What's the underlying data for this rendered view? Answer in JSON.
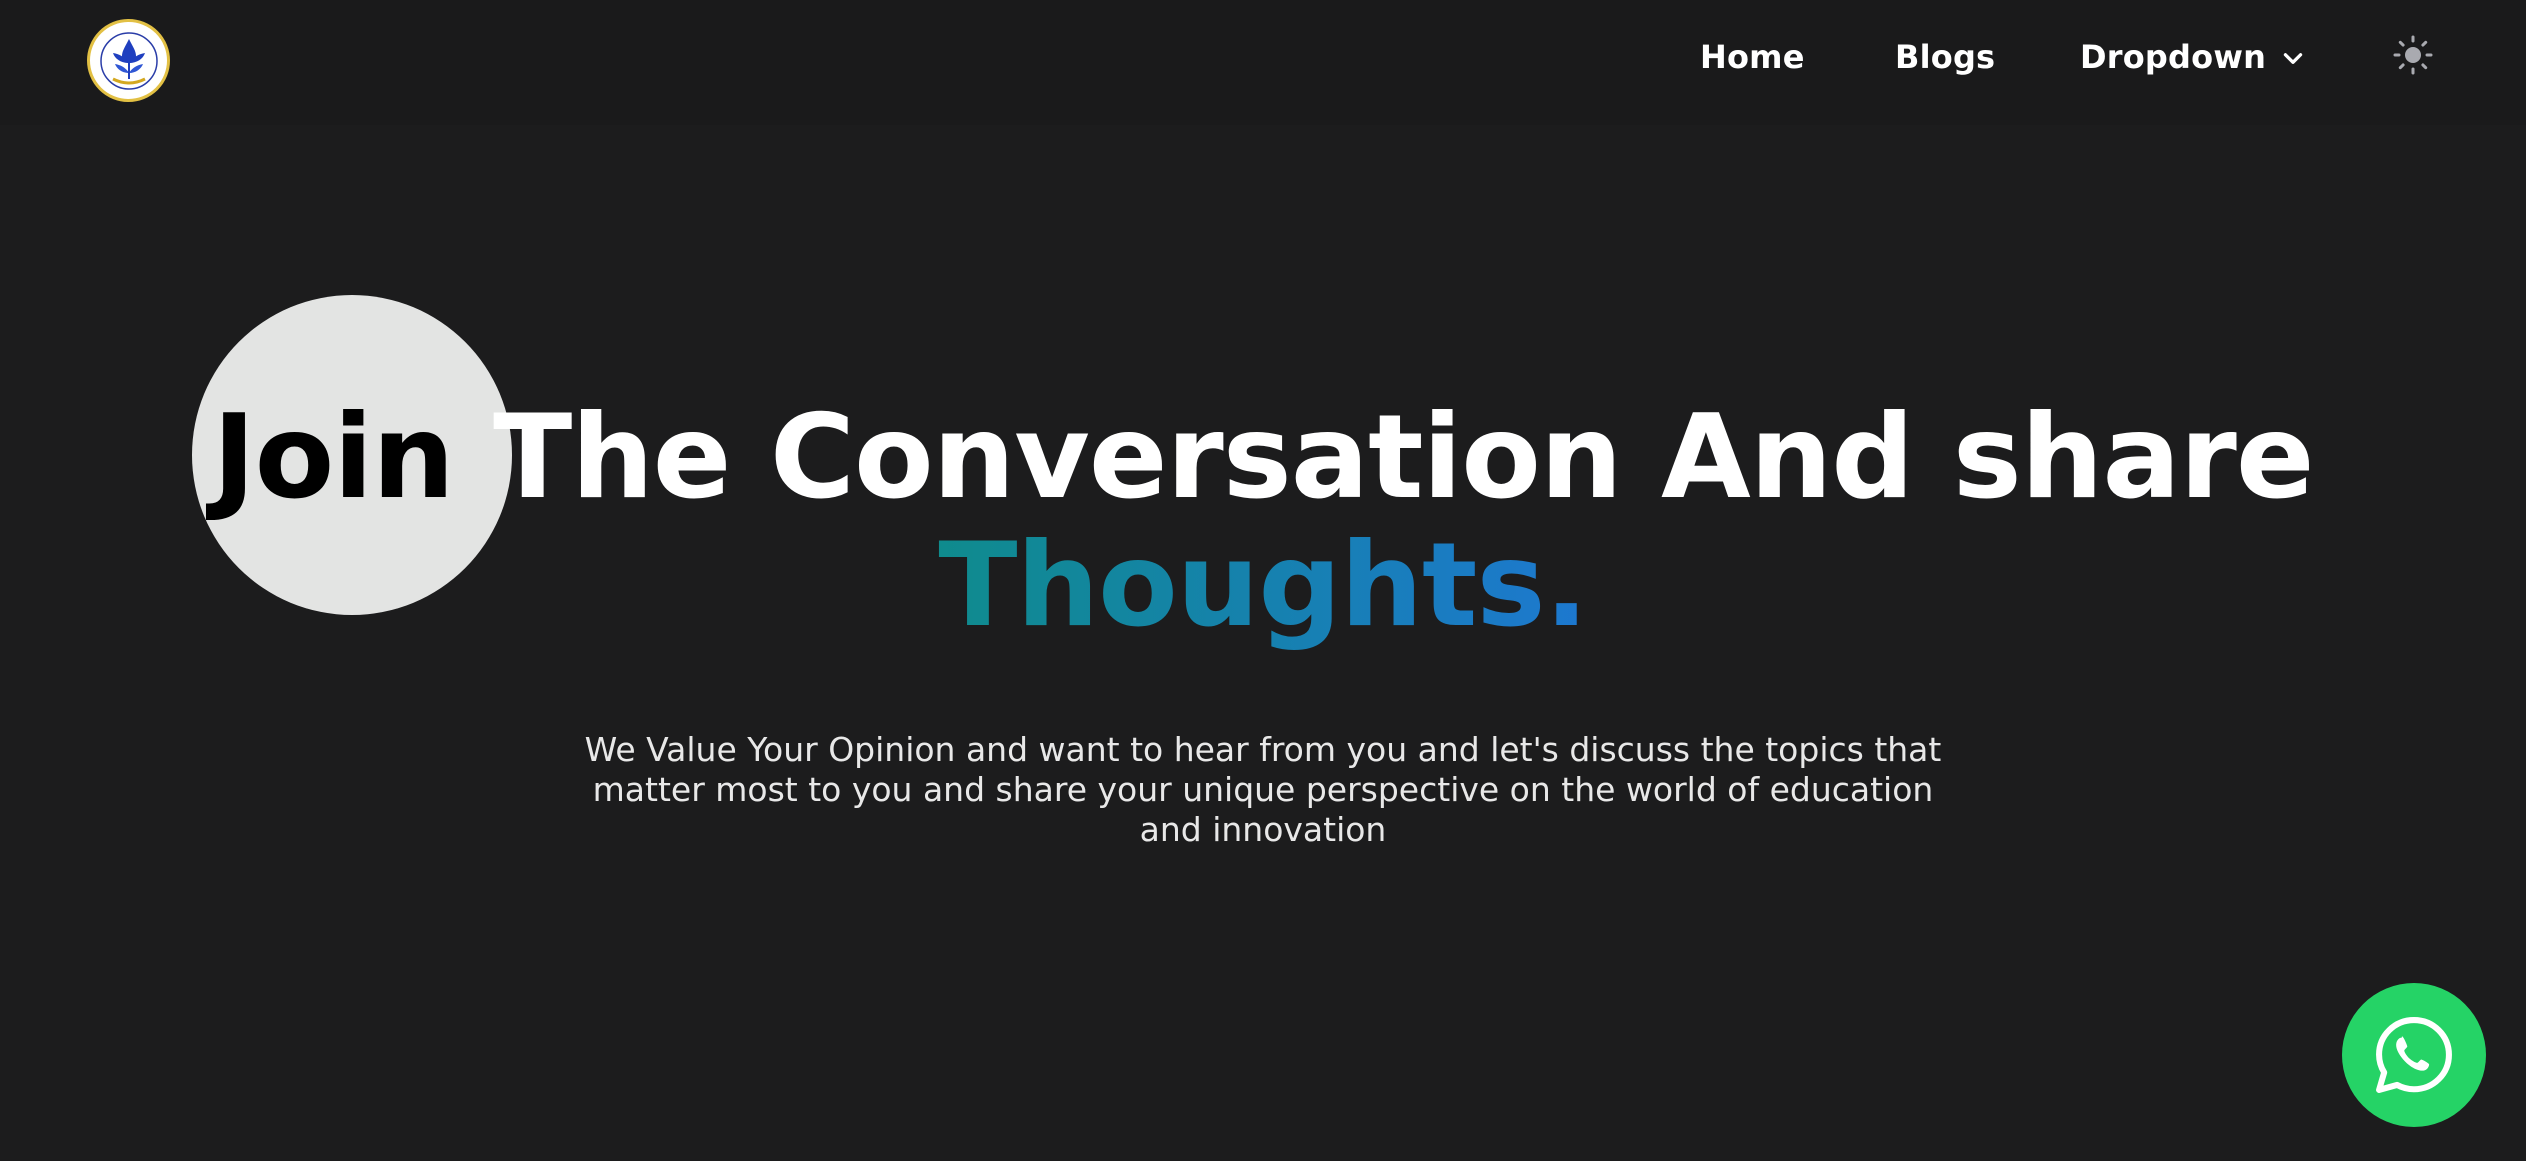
{
  "nav": {
    "links": [
      {
        "label": "Home"
      },
      {
        "label": "Blogs"
      },
      {
        "label": "Dropdown"
      }
    ]
  },
  "hero": {
    "headline_highlight": "Join",
    "headline_rest": " The Conversation And share",
    "headline_line2": "Thoughts.",
    "subtext": "We Value Your Opinion and want to hear from you and let's discuss the topics that matter most to you and share your unique perspective on the world of education and innovation"
  },
  "icons": {
    "logo": "leaf-drop-logo-icon",
    "dropdown": "chevron-down-icon",
    "theme": "sun-icon",
    "whatsapp": "whatsapp-icon"
  },
  "colors": {
    "background": "#1c1c1d",
    "circle": "#e3e4e3",
    "gradient_start": "#0f8b8d",
    "gradient_end": "#1d78d0",
    "whatsapp": "#25d366"
  }
}
